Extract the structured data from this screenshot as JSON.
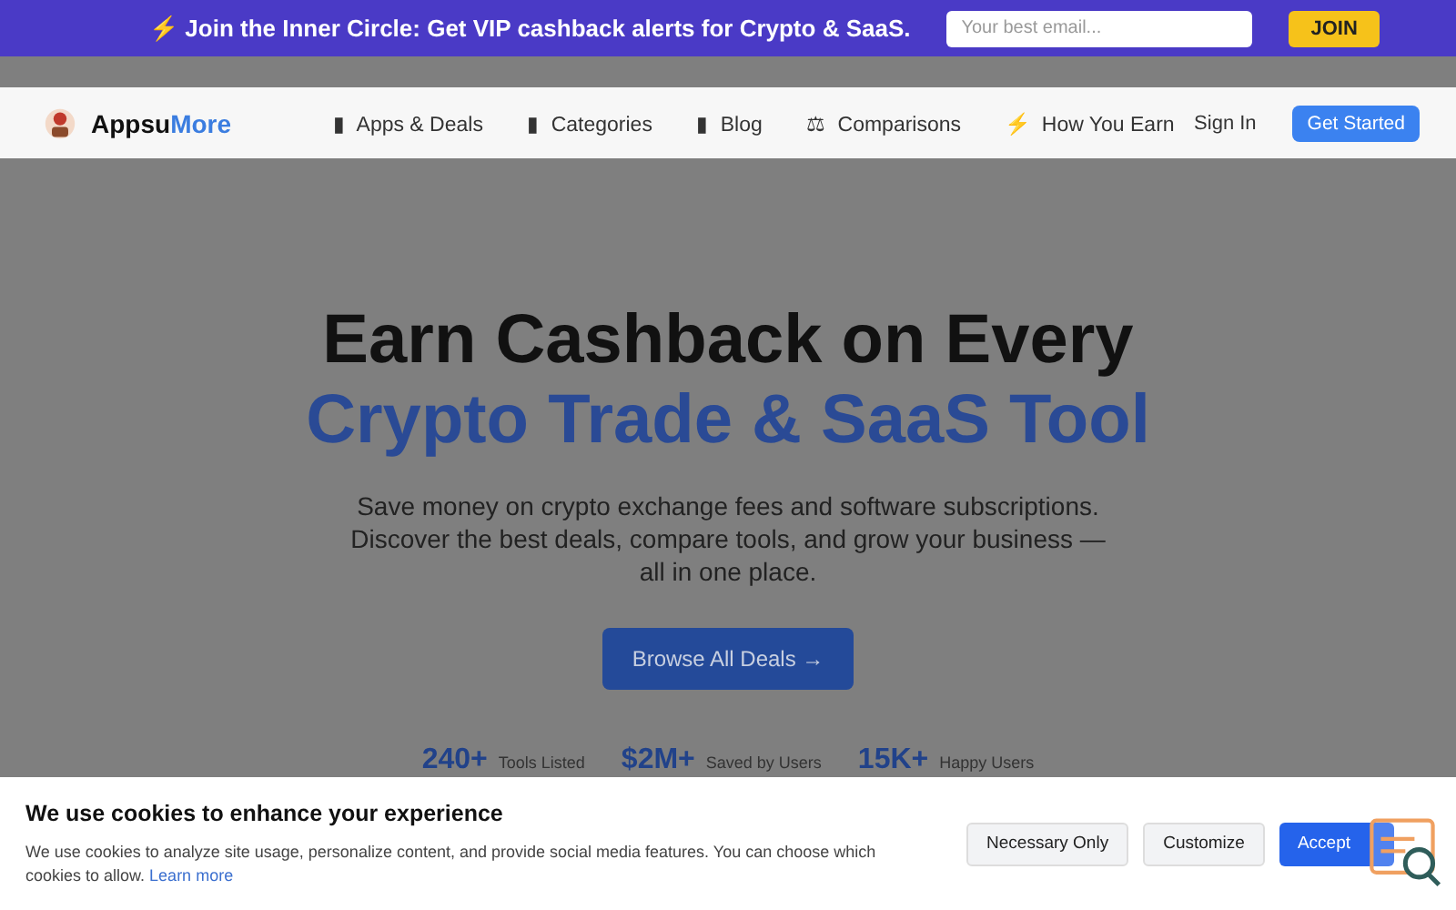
{
  "promo": {
    "icon": "⚡",
    "text": "Join the Inner Circle: Get VIP cashback alerts for Crypto & SaaS.",
    "email_placeholder": "Your best email...",
    "button": "JOIN"
  },
  "nav": {
    "brand_a": "Appsu",
    "brand_b": "More",
    "items": [
      {
        "icon": "▮",
        "label": "Apps & Deals"
      },
      {
        "icon": "▮",
        "label": "Categories"
      },
      {
        "icon": "▮",
        "label": "Blog"
      },
      {
        "icon": "⚖",
        "label": "Comparisons"
      },
      {
        "icon": "⚡",
        "label": "How You Earn"
      }
    ],
    "sign_in": "Sign In",
    "get_started": "Get Started"
  },
  "hero": {
    "title_1": "Earn Cashback on Every",
    "title_2": "Crypto Trade & SaaS Tool",
    "subtitle": "Save money on crypto exchange fees and software subscriptions. Discover the best deals, compare tools, and grow your business — all in one place.",
    "button": "Browse All Deals →",
    "stats": [
      {
        "value": "240+",
        "label": "Tools Listed"
      },
      {
        "value": "$2M+",
        "label": "Saved by Users"
      },
      {
        "value": "15K+",
        "label": "Happy Users"
      }
    ]
  },
  "cookie": {
    "title": "We use cookies to enhance your experience",
    "text": "We use cookies to analyze site usage, personalize content, and provide social media features. You can choose which cookies to allow.",
    "link": "Learn more",
    "buttons": [
      {
        "kind": "secondary",
        "label": "Necessary Only"
      },
      {
        "kind": "secondary",
        "label": "Customize"
      },
      {
        "kind": "primary",
        "label": "Accept"
      }
    ]
  }
}
